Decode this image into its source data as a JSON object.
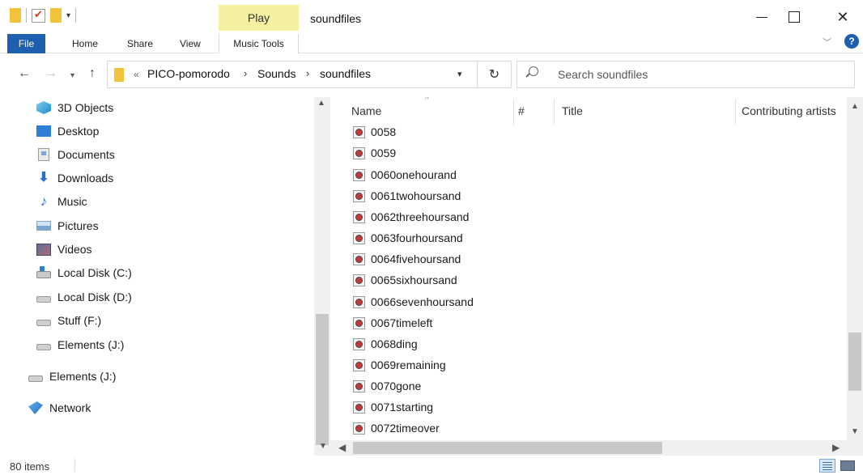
{
  "window": {
    "title": "soundfiles",
    "contextual_tab": "Play"
  },
  "ribbon": {
    "tabs": [
      "File",
      "Home",
      "Share",
      "View",
      "Music Tools"
    ],
    "help_label": "?"
  },
  "address": {
    "overflow": "«",
    "crumbs": [
      "PICO-pomorodo",
      "Sounds",
      "soundfiles"
    ],
    "separator": "›"
  },
  "search": {
    "placeholder": "Search soundfiles"
  },
  "nav_pane": {
    "items": [
      {
        "label": "3D Objects",
        "icon": "3d-objects-icon"
      },
      {
        "label": "Desktop",
        "icon": "desktop-icon"
      },
      {
        "label": "Documents",
        "icon": "documents-icon"
      },
      {
        "label": "Downloads",
        "icon": "downloads-icon"
      },
      {
        "label": "Music",
        "icon": "music-icon"
      },
      {
        "label": "Pictures",
        "icon": "pictures-icon"
      },
      {
        "label": "Videos",
        "icon": "videos-icon"
      },
      {
        "label": "Local Disk (C:)",
        "icon": "windows-drive-icon"
      },
      {
        "label": "Local Disk (D:)",
        "icon": "drive-icon"
      },
      {
        "label": "Stuff (F:)",
        "icon": "drive-icon"
      },
      {
        "label": "Elements (J:)",
        "icon": "drive-icon"
      },
      {
        "label": "Elements (J:)",
        "icon": "drive-icon"
      },
      {
        "label": "Network",
        "icon": "network-icon"
      }
    ]
  },
  "columns": [
    "Name",
    "#",
    "Title",
    "Contributing artists"
  ],
  "files": [
    "0058",
    "0059",
    "0060onehourand",
    "0061twohoursand",
    "0062threehoursand",
    "0063fourhoursand",
    "0064fivehoursand",
    "0065sixhoursand",
    "0066sevenhoursand",
    "0067timeleft",
    "0068ding",
    "0069remaining",
    "0070gone",
    "0071starting",
    "0072timeover"
  ],
  "status": {
    "item_count": "80 items"
  },
  "colors": {
    "accent": "#1f5fb0",
    "play_tab": "#f5f0a0",
    "folder": "#f2c23a"
  }
}
